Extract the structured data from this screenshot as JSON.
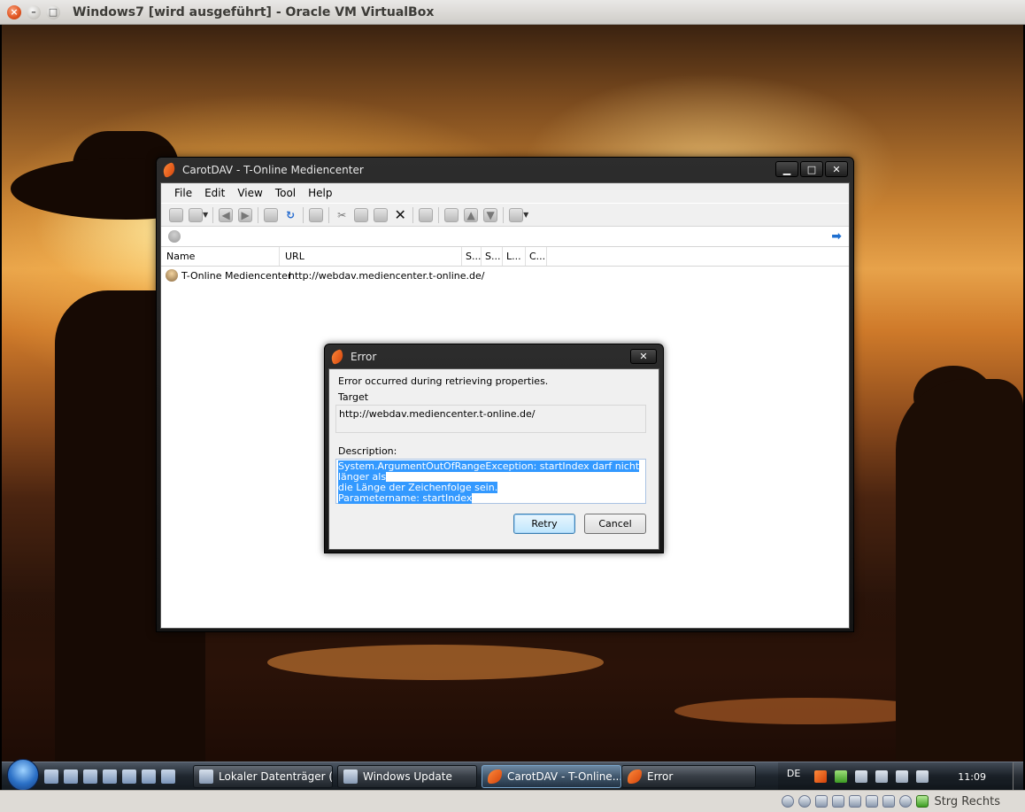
{
  "host": {
    "title": "Windows7 [wird ausgeführt] - Oracle VM VirtualBox",
    "host_key": "Strg Rechts"
  },
  "carotdav": {
    "title": "CarotDAV - T-Online Mediencenter",
    "menu": [
      "File",
      "Edit",
      "View",
      "Tool",
      "Help"
    ],
    "list_columns": [
      "Name",
      "URL",
      "S...",
      "S...",
      "L...",
      "C..."
    ],
    "rows": [
      {
        "name": "T-Online Mediencenter",
        "url": "http://webdav.mediencenter.t-online.de/"
      }
    ]
  },
  "error_dialog": {
    "title": "Error",
    "message": "Error occurred during retrieving properties.",
    "target_label": "Target",
    "target_value": "http://webdav.mediencenter.t-online.de/",
    "description_label": "Description:",
    "description_lines": [
      "System.ArgumentOutOfRangeException: startIndex darf nicht länger als",
      "die Länge der Zeichenfolge sein.",
      "Parametername: startIndex"
    ],
    "retry_label": "Retry",
    "cancel_label": "Cancel"
  },
  "taskbar": {
    "tasks": [
      {
        "label": "Lokaler Datenträger (...",
        "active": false
      },
      {
        "label": "Windows Update",
        "active": false
      },
      {
        "label": "CarotDAV - T-Online...",
        "active": true
      },
      {
        "label": "Error",
        "active": false
      }
    ],
    "language": "DE",
    "clock": "11:09"
  },
  "colors": {
    "selection": "#3399ff",
    "host_close": "#e0531f",
    "taskbar": "#1f262e"
  }
}
